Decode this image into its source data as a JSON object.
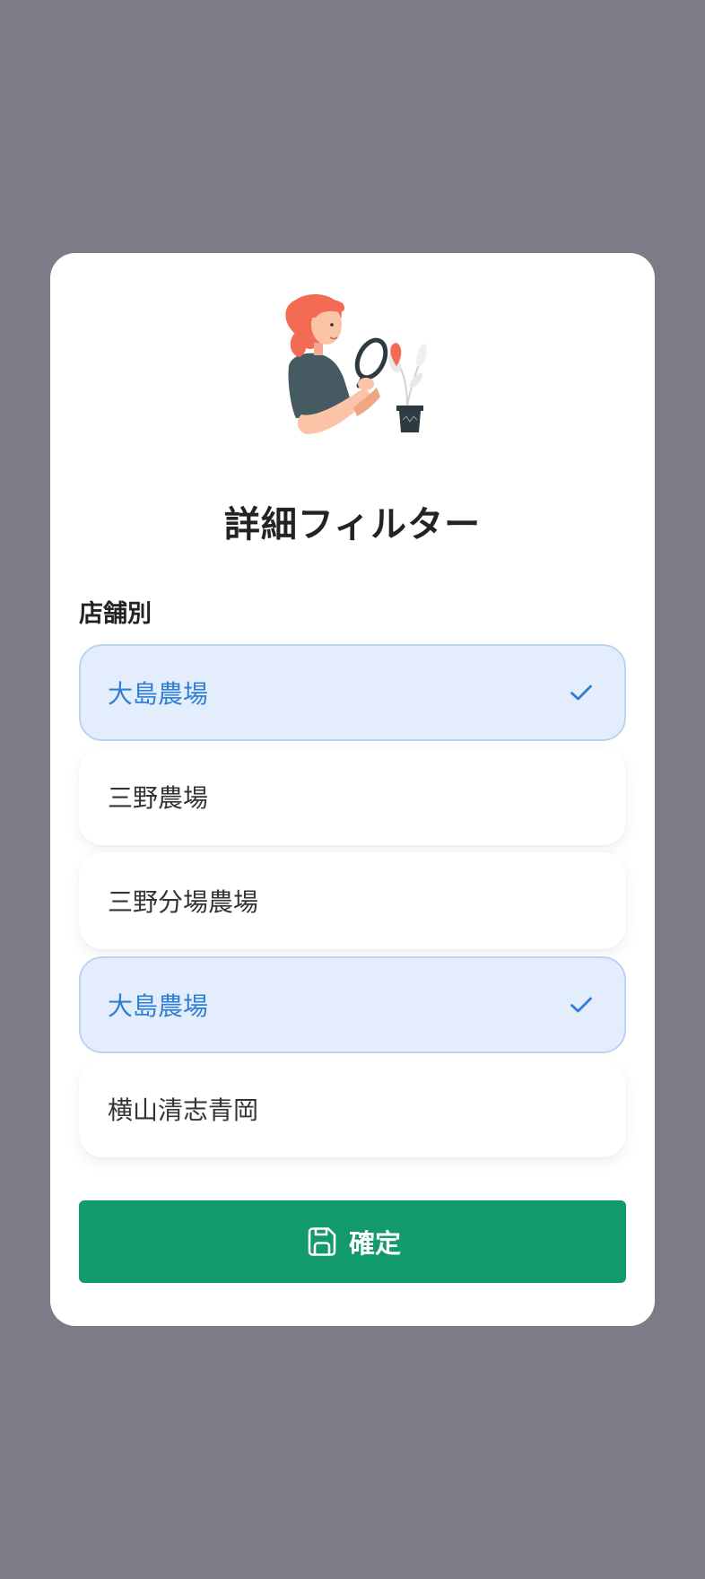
{
  "modal": {
    "title": "詳細フィルター",
    "section_label": "店舗別",
    "illustration": "woman-with-magnifying-glass-and-plant"
  },
  "options": [
    {
      "label": "大島農場",
      "selected": true
    },
    {
      "label": "三野農場",
      "selected": false
    },
    {
      "label": "三野分場農場",
      "selected": false
    },
    {
      "label": "大島農場",
      "selected": true
    },
    {
      "label": "横山清志青岡",
      "selected": false
    }
  ],
  "confirm": {
    "label": "確定",
    "icon": "save-icon"
  },
  "colors": {
    "overlay": "#7c7c86",
    "selected_bg": "#e4edfb",
    "selected_text": "#2f7fd6",
    "button": "#129a6c"
  }
}
